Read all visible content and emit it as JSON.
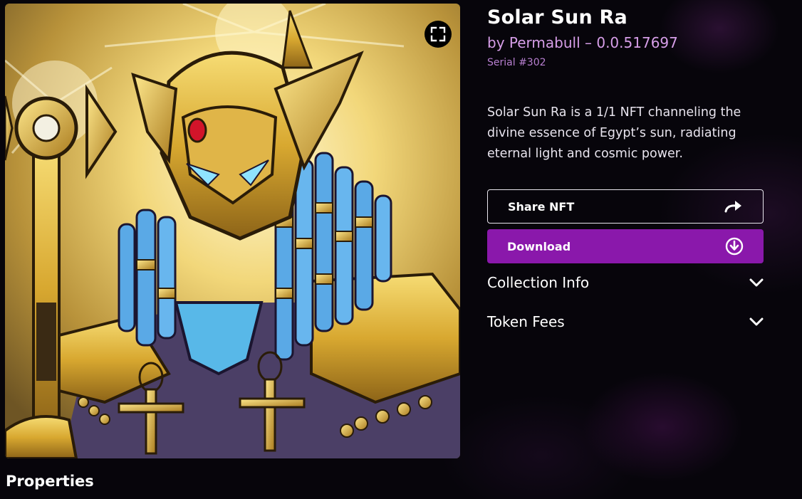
{
  "nft": {
    "title": "Solar Sun Ra",
    "creator_line": "by Permabull – 0.0.517697",
    "serial": "Serial #302",
    "description": "Solar Sun Ra is a 1/1 NFT channeling the divine essence of Egypt’s sun, radiating eternal light and cosmic power."
  },
  "actions": {
    "share_label": "Share NFT",
    "download_label": "Download"
  },
  "accordions": [
    {
      "label": "Collection Info"
    },
    {
      "label": "Token Fees"
    }
  ],
  "sections": {
    "properties_heading": "Properties"
  },
  "icons": {
    "expand": "expand-icon",
    "share": "share-arrow-icon",
    "download": "download-circle-icon",
    "chevron": "chevron-down-icon"
  },
  "colors": {
    "accent": "#8a18ab",
    "creator_text": "#d69ee8",
    "serial_text": "#b77fd0",
    "background": "#07050b"
  }
}
